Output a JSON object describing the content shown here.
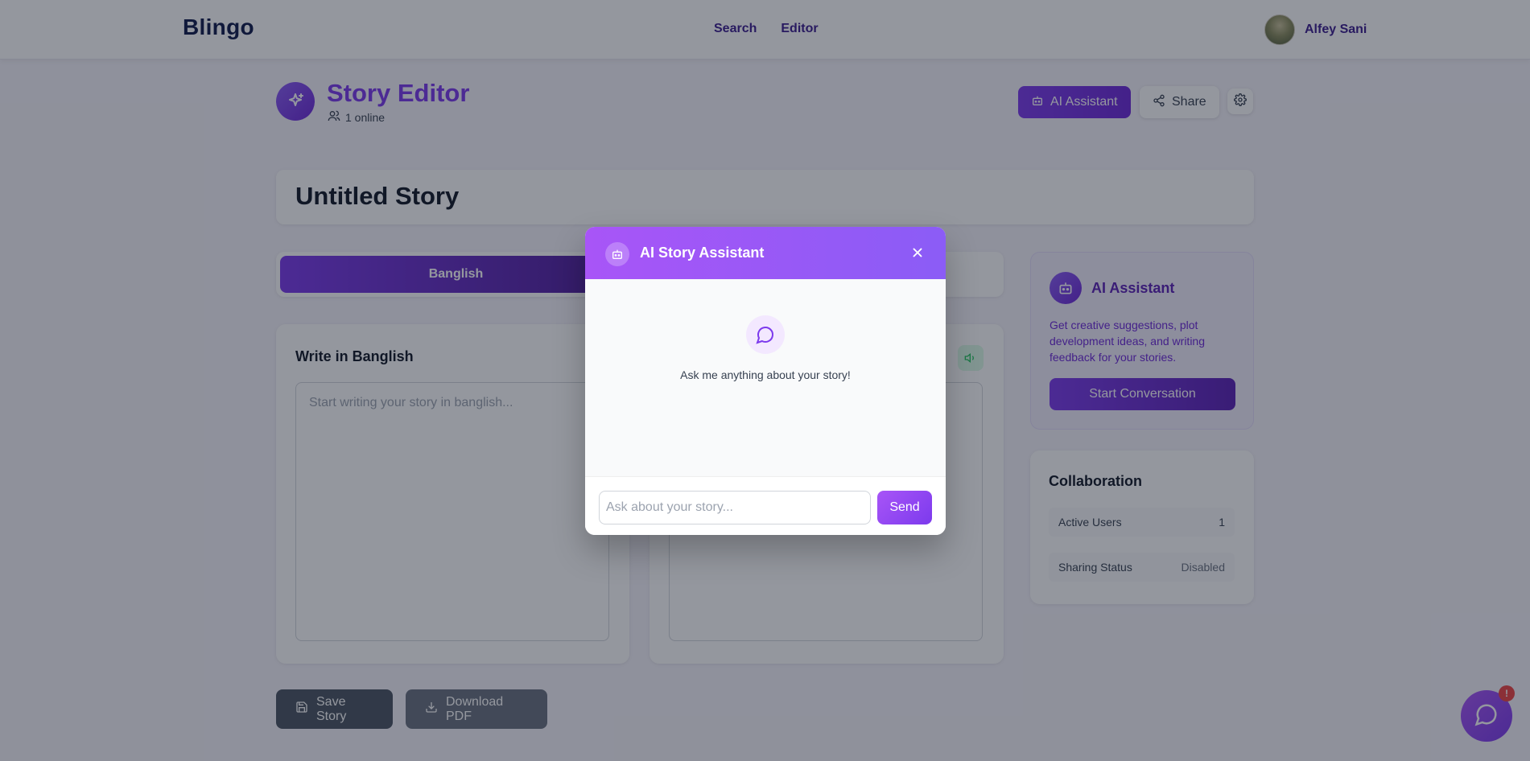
{
  "nav": {
    "brand": "Blingo",
    "links": [
      "Search",
      "Editor"
    ],
    "user_name": "Alfey Sani"
  },
  "header": {
    "title": "Story Editor",
    "online": "1 online",
    "ai_button": "AI Assistant",
    "share_button": "Share"
  },
  "story": {
    "title": "Untitled Story"
  },
  "tabs": {
    "active": "Banglish"
  },
  "editor": {
    "left_title": "Write in Banglish",
    "left_placeholder": "Start writing your story in banglish..."
  },
  "sidebar": {
    "ai_title": "AI Assistant",
    "ai_desc": "Get creative suggestions, plot development ideas, and writing feedback for your stories.",
    "ai_button": "Start Conversation",
    "collab_title": "Collaboration",
    "active_users_label": "Active Users",
    "active_users_value": "1",
    "sharing_label": "Sharing Status",
    "sharing_value": "Disabled"
  },
  "actions": {
    "save": "Save Story",
    "pdf": "Download PDF"
  },
  "fab": {
    "badge": "!"
  },
  "modal": {
    "title": "AI Story Assistant",
    "empty_text": "Ask me anything about your story!",
    "input_placeholder": "Ask about your story...",
    "send": "Send"
  },
  "colors": {
    "brand": "#7c3aed",
    "accent_gradient_start": "#a855f7",
    "badge": "#ef4444"
  }
}
